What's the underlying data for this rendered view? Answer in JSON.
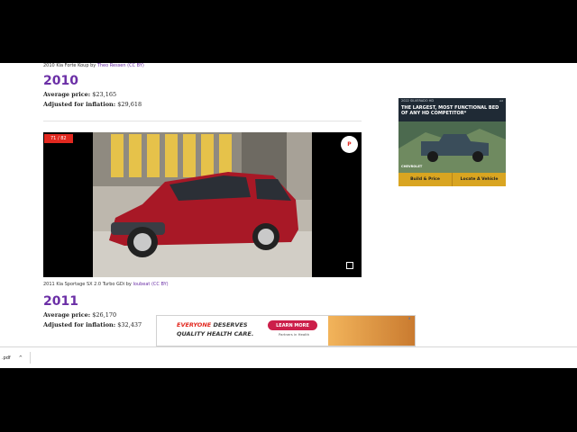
{
  "article": {
    "caption_prev": "2010 Kia Forte Koup by",
    "caption_prev_credit": "Theo Ressen (CC BY)",
    "section_2010": {
      "year": "2010",
      "avg_label": "Average price:",
      "avg_value": "$23,165",
      "infl_label": "Adjusted for inflation:",
      "infl_value": "$29,618"
    },
    "gallery": {
      "counter": "71 / 82",
      "pin_label": "P",
      "caption": "2011 Kia Sportage SX 2.0 Turbo GDi by",
      "caption_credit": "loubeat (CC BY)"
    },
    "section_2011": {
      "year": "2011",
      "avg_label": "Average price:",
      "avg_value": "$26,170",
      "infl_label": "Adjusted for inflation:",
      "infl_value": "$32,437"
    }
  },
  "ad_side": {
    "tag": "2022 SILVERADO HD",
    "source": "Ad",
    "headline": "THE LARGEST, MOST FUNCTIONAL BED OF ANY HD COMPETITOR*",
    "brand": "CHEVROLET",
    "btn_build": "Build & Price",
    "btn_locate": "Locate A Vehicle"
  },
  "ad_bottom": {
    "highlight": "EVERYONE",
    "line1_rest": " DESERVES",
    "line2": "QUALITY HEALTH CARE.",
    "learn_more": "LEARN MORE",
    "partners": "Partners in Health",
    "close": "x"
  },
  "download_bar": {
    "file": ".pdf",
    "chevron": "^"
  },
  "colors": {
    "accent": "#6b2fa6",
    "counter_red": "#e2281f",
    "ad_gold": "#d9a521"
  }
}
